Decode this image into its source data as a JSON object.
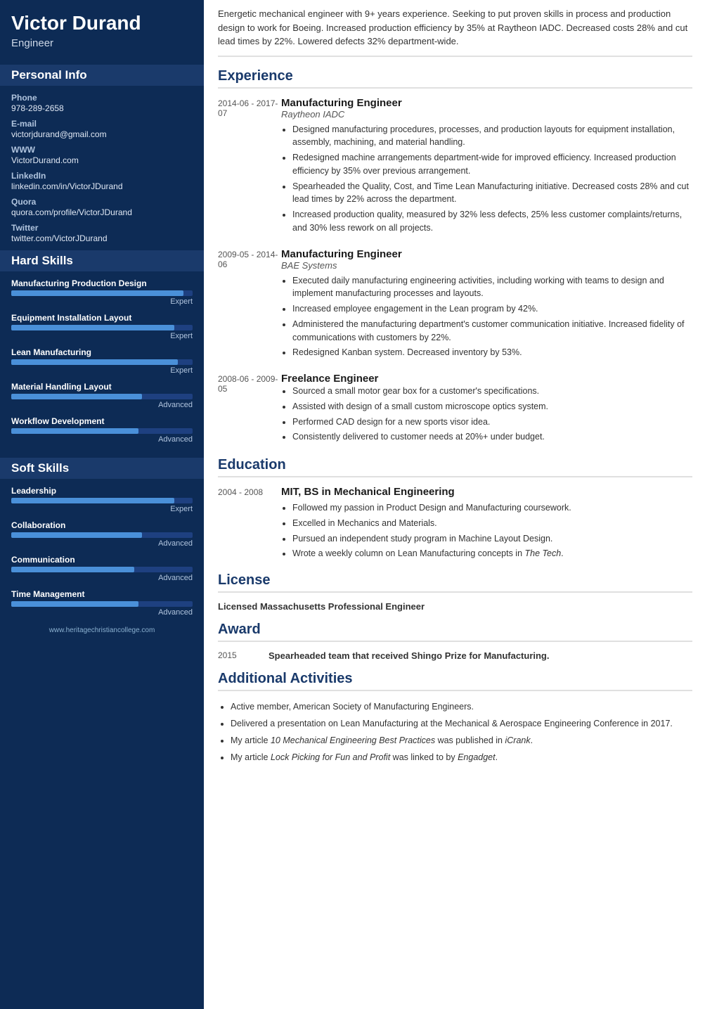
{
  "sidebar": {
    "name": "Victor Durand",
    "title": "Engineer",
    "personal_info_title": "Personal Info",
    "fields": [
      {
        "label": "Phone",
        "value": "978-289-2658"
      },
      {
        "label": "E-mail",
        "value": "victorjdurand@gmail.com"
      },
      {
        "label": "WWW",
        "value": "VictorDurand.com"
      },
      {
        "label": "LinkedIn",
        "value": "linkedin.com/in/VictorJDurand"
      },
      {
        "label": "Quora",
        "value": "quora.com/profile/VictorJDurand"
      },
      {
        "label": "Twitter",
        "value": "twitter.com/VictorJDurand"
      }
    ],
    "hard_skills_title": "Hard Skills",
    "hard_skills": [
      {
        "name": "Manufacturing Production Design",
        "fill": 95,
        "level": "Expert"
      },
      {
        "name": "Equipment Installation Layout",
        "fill": 90,
        "level": "Expert"
      },
      {
        "name": "Lean Manufacturing",
        "fill": 92,
        "level": "Expert"
      },
      {
        "name": "Material Handling Layout",
        "fill": 72,
        "level": "Advanced"
      },
      {
        "name": "Workflow Development",
        "fill": 70,
        "level": "Advanced"
      }
    ],
    "soft_skills_title": "Soft Skills",
    "soft_skills": [
      {
        "name": "Leadership",
        "fill": 90,
        "level": "Expert"
      },
      {
        "name": "Collaboration",
        "fill": 72,
        "level": "Advanced"
      },
      {
        "name": "Communication",
        "fill": 68,
        "level": "Advanced"
      },
      {
        "name": "Time Management",
        "fill": 70,
        "level": "Advanced"
      }
    ],
    "footer": "www.heritagechristiancollege.com"
  },
  "main": {
    "summary": "Energetic mechanical engineer with 9+ years experience. Seeking to put proven skills in process and production design to work for Boeing. Increased production efficiency by 35% at Raytheon IADC. Decreased costs 28% and cut lead times by 22%. Lowered defects 32% department-wide.",
    "experience_title": "Experience",
    "experiences": [
      {
        "dates": "2014-06 - 2017-07",
        "title": "Manufacturing Engineer",
        "company": "Raytheon IADC",
        "bullets": [
          "Designed manufacturing procedures, processes, and production layouts for equipment installation, assembly, machining, and material handling.",
          "Redesigned machine arrangements department-wide for improved efficiency. Increased production efficiency by 35% over previous arrangement.",
          "Spearheaded the Quality, Cost, and Time Lean Manufacturing initiative. Decreased costs 28% and cut lead times by 22% across the department.",
          "Increased production quality, measured by 32% less defects, 25% less customer complaints/returns, and 30% less rework on all projects."
        ]
      },
      {
        "dates": "2009-05 - 2014-06",
        "title": "Manufacturing Engineer",
        "company": "BAE Systems",
        "bullets": [
          "Executed daily manufacturing engineering activities, including working with teams to design and implement manufacturing processes and layouts.",
          "Increased employee engagement in the Lean program by 42%.",
          "Administered the manufacturing department's customer communication initiative. Increased fidelity of communications with customers by 22%.",
          "Redesigned Kanban system. Decreased inventory by 53%."
        ]
      },
      {
        "dates": "2008-06 - 2009-05",
        "title": "Freelance Engineer",
        "company": "",
        "bullets": [
          "Sourced a small motor gear box for a customer's specifications.",
          "Assisted with design of a small custom microscope optics system.",
          "Performed CAD design for a new sports visor idea.",
          "Consistently delivered to customer needs at 20%+ under budget."
        ]
      }
    ],
    "education_title": "Education",
    "educations": [
      {
        "dates": "2004 - 2008",
        "degree": "MIT, BS in Mechanical Engineering",
        "bullets": [
          "Followed my passion in Product Design and Manufacturing coursework.",
          "Excelled in Mechanics and Materials.",
          "Pursued an independent study program in Machine Layout Design.",
          "Wrote a weekly column on Lean Manufacturing concepts in The Tech."
        ]
      }
    ],
    "license_title": "License",
    "license_text": "Licensed Massachusetts Professional Engineer",
    "award_title": "Award",
    "awards": [
      {
        "year": "2015",
        "text": "Spearheaded team that received Shingo Prize for Manufacturing."
      }
    ],
    "activities_title": "Additional Activities",
    "activities": [
      "Active member, American Society of Manufacturing Engineers.",
      "Delivered a presentation on Lean Manufacturing at the Mechanical & Aerospace Engineering Conference in 2017.",
      "My article 10 Mechanical Engineering Best Practices was published in iCrank.",
      "My article Lock Picking for Fun and Profit was linked to by Engadget."
    ]
  }
}
